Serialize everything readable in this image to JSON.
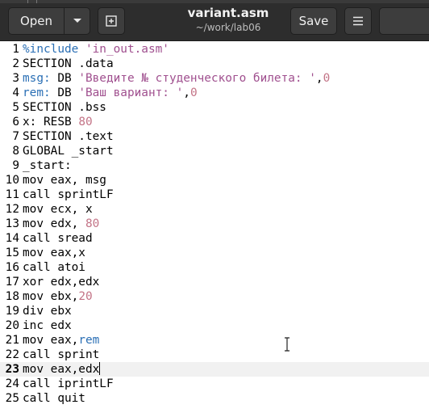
{
  "header": {
    "open_label": "Open",
    "save_label": "Save",
    "title": "variant.asm",
    "subtitle": "~/work/lab06"
  },
  "editor": {
    "current_line": 23,
    "lines": [
      {
        "n": "1",
        "tokens": [
          {
            "t": "%include",
            "c": "kw-blue"
          },
          {
            "t": " ",
            "c": ""
          },
          {
            "t": "'in_out.asm'",
            "c": "str"
          }
        ]
      },
      {
        "n": "2",
        "tokens": [
          {
            "t": "SECTION .data",
            "c": ""
          }
        ]
      },
      {
        "n": "3",
        "tokens": [
          {
            "t": "msg:",
            "c": "kw-blue"
          },
          {
            "t": " DB ",
            "c": ""
          },
          {
            "t": "'Введите № студенческого билета: '",
            "c": "str"
          },
          {
            "t": ",",
            "c": ""
          },
          {
            "t": "0",
            "c": "num"
          }
        ]
      },
      {
        "n": "4",
        "tokens": [
          {
            "t": "rem:",
            "c": "kw-blue"
          },
          {
            "t": " DB ",
            "c": ""
          },
          {
            "t": "'Ваш вариант: '",
            "c": "str"
          },
          {
            "t": ",",
            "c": ""
          },
          {
            "t": "0",
            "c": "num"
          }
        ]
      },
      {
        "n": "5",
        "tokens": [
          {
            "t": "SECTION .bss",
            "c": ""
          }
        ]
      },
      {
        "n": "6",
        "tokens": [
          {
            "t": "x: RESB ",
            "c": ""
          },
          {
            "t": "80",
            "c": "num"
          }
        ]
      },
      {
        "n": "7",
        "tokens": [
          {
            "t": "SECTION .text",
            "c": ""
          }
        ]
      },
      {
        "n": "8",
        "tokens": [
          {
            "t": "GLOBAL _start",
            "c": ""
          }
        ]
      },
      {
        "n": "9",
        "tokens": [
          {
            "t": "_start:",
            "c": ""
          }
        ]
      },
      {
        "n": "10",
        "tokens": [
          {
            "t": "mov eax, msg",
            "c": ""
          }
        ]
      },
      {
        "n": "11",
        "tokens": [
          {
            "t": "call sprintLF",
            "c": ""
          }
        ]
      },
      {
        "n": "12",
        "tokens": [
          {
            "t": "mov ecx, x",
            "c": ""
          }
        ]
      },
      {
        "n": "13",
        "tokens": [
          {
            "t": "mov edx, ",
            "c": ""
          },
          {
            "t": "80",
            "c": "num"
          }
        ]
      },
      {
        "n": "14",
        "tokens": [
          {
            "t": "call sread",
            "c": ""
          }
        ]
      },
      {
        "n": "15",
        "tokens": [
          {
            "t": "mov eax,x",
            "c": ""
          }
        ]
      },
      {
        "n": "16",
        "tokens": [
          {
            "t": "call atoi",
            "c": ""
          }
        ]
      },
      {
        "n": "17",
        "tokens": [
          {
            "t": "xor edx,edx",
            "c": ""
          }
        ]
      },
      {
        "n": "18",
        "tokens": [
          {
            "t": "mov ebx,",
            "c": ""
          },
          {
            "t": "20",
            "c": "num"
          }
        ]
      },
      {
        "n": "19",
        "tokens": [
          {
            "t": "div ebx",
            "c": ""
          }
        ]
      },
      {
        "n": "20",
        "tokens": [
          {
            "t": "inc edx",
            "c": ""
          }
        ]
      },
      {
        "n": "21",
        "tokens": [
          {
            "t": "mov eax,",
            "c": ""
          },
          {
            "t": "rem",
            "c": "kw-blue"
          }
        ]
      },
      {
        "n": "22",
        "tokens": [
          {
            "t": "call sprint",
            "c": ""
          }
        ]
      },
      {
        "n": "23",
        "tokens": [
          {
            "t": "mov eax,edx",
            "c": ""
          }
        ]
      },
      {
        "n": "24",
        "tokens": [
          {
            "t": "call iprintLF",
            "c": ""
          }
        ]
      },
      {
        "n": "25",
        "tokens": [
          {
            "t": "call quit",
            "c": ""
          }
        ]
      }
    ]
  }
}
